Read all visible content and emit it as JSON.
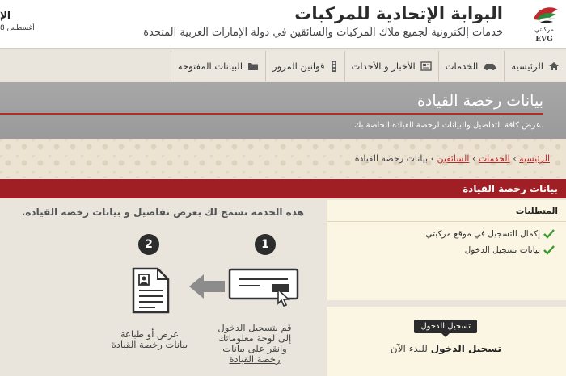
{
  "header": {
    "title": "البوابة الإتحادية للمركبات",
    "subtitle": "خدمات إلكترونية لجميع ملاك المركبات والسائقين في دولة الإمارات العربية المتحدة",
    "logo_text": "مركبتي",
    "logo_abbr": "EVG",
    "date": "8 أغسطس",
    "corner": "الإ"
  },
  "nav": {
    "items": [
      {
        "label": "الرئيسية",
        "icon": "home-icon"
      },
      {
        "label": "الخدمات",
        "icon": "car-icon"
      },
      {
        "label": "الأخبار و الأحداث",
        "icon": "news-icon"
      },
      {
        "label": "قوانين المرور",
        "icon": "traffic-light-icon"
      },
      {
        "label": "البيانات المفتوحة",
        "icon": "folder-icon"
      }
    ]
  },
  "banner": {
    "title": "بيانات رخصة القيادة",
    "subtitle": "عرض كافة التفاصيل والبيانات لرخصة القيادة الخاصة بك."
  },
  "breadcrumb": {
    "home": "الرئيسية",
    "services": "الخدمات",
    "drivers": "السائقين",
    "current": "بيانات رخصة القيادة",
    "separator": "›"
  },
  "section": {
    "title": "بيانات رخصة القيادة"
  },
  "requirements": {
    "heading": "المتطلبات",
    "items": [
      "إكمال التسجيل في موقع مركبتي",
      "بيانات تسجيل الدخول"
    ]
  },
  "login": {
    "badge": "تسجيل الدخول",
    "text_bold": "تسجيل الدخول",
    "text_rest": " للبدء الآن"
  },
  "intro": "هذه الخدمة تسمح لك بعرض تفاصيل و بيانات رخصة القيادة.",
  "steps": [
    {
      "number": "1",
      "line1": "قم بتسجيل الدخول",
      "line2": "إلى لوحة معلوماتك",
      "line3_a": "وانقر على ",
      "line3_link": "بيانات",
      "line4": "رخصة القيادة"
    },
    {
      "number": "2",
      "line1": "عرض أو طباعة",
      "line2": "بيانات رخصة القيادة"
    }
  ],
  "colors": {
    "accent_red": "#a01f25",
    "check_green": "#3a9a2e",
    "banner_gray": "#a3a3a3"
  }
}
